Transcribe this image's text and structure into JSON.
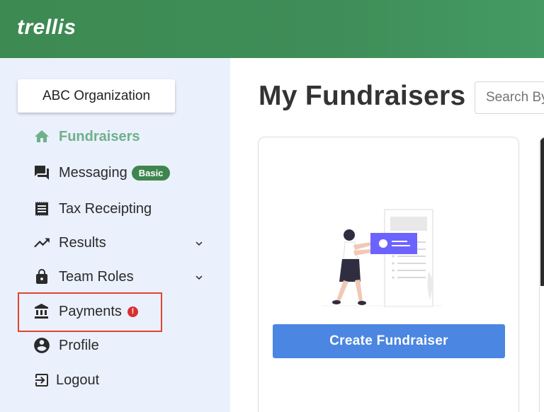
{
  "header": {
    "logo": "trellis"
  },
  "sidebar": {
    "org_button": "ABC Organization",
    "items": [
      {
        "label": "Fundraisers",
        "icon": "home-icon",
        "active": true
      },
      {
        "label": "Messaging",
        "icon": "chat-icon",
        "badge": "Basic"
      },
      {
        "label": "Tax Receipting",
        "icon": "receipt-icon"
      },
      {
        "label": "Results",
        "icon": "trending-up-icon",
        "expandable": true
      },
      {
        "label": "Team Roles",
        "icon": "lock-icon",
        "expandable": true
      },
      {
        "label": "Payments",
        "icon": "bank-icon",
        "alert": "!"
      },
      {
        "label": "Profile",
        "icon": "account-circle-icon"
      },
      {
        "label": "Logout",
        "icon": "logout-icon"
      }
    ]
  },
  "main": {
    "title": "My Fundraisers",
    "search_placeholder": "Search By",
    "create_button": "Create Fundraiser"
  },
  "colors": {
    "header_green": "#3f8d58",
    "sidebar_bg": "#eaf0fc",
    "active_green": "#6fb08a",
    "badge_green": "#3e8550",
    "alert_red": "#d8302f",
    "primary_blue": "#4a86e2",
    "illustration_purple": "#6c63ff"
  }
}
